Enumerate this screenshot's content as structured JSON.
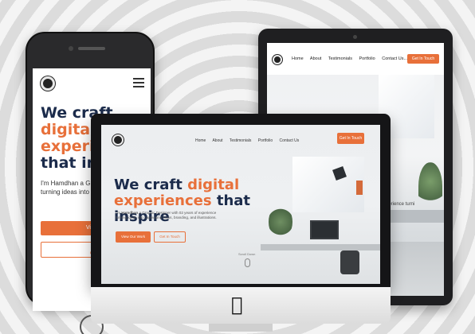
{
  "brand": {
    "accent": "#e8703a",
    "heading": "#1b2b4b"
  },
  "phone": {
    "headline_line1": "We craft",
    "headline_line2": "digital",
    "headline_line3": "experie",
    "headline_line4": "that ins",
    "intro": "I'm Hamdhan a G with 02 years of ex turning ideas into logos, branding, a",
    "intro_name": "Hamdhan",
    "primary_button": "View Ou",
    "secondary_button_line1": "Scroll",
    "secondary_button_line2": "Get in",
    "menu_icon": "hamburger-icon"
  },
  "tablet": {
    "nav": [
      "Home",
      "About",
      "Testimonials",
      "Portfolio",
      "Contact Us..."
    ],
    "cta": "Get In Touch",
    "partial_text": "xperience turni"
  },
  "imac": {
    "nav": [
      "Home",
      "About",
      "Testimonials",
      "Portfolio",
      "Contact Us"
    ],
    "cta": "Get In Touch",
    "headline_part1": "We craft ",
    "headline_accent1": "digital",
    "headline_accent2": "experiences",
    "headline_part2": " that inspire",
    "intro_prefix": "I'm ",
    "intro_name": "Hamdhan",
    "intro_rest": " a Graphic Designer with 02 years of experience turning ideas into captivating logos, branding, and illustrations.",
    "primary_button": "View Our Work",
    "secondary_button": "Get In Touch",
    "scroll_label": "Scroll Down",
    "apple_icon": "apple-logo-icon"
  }
}
